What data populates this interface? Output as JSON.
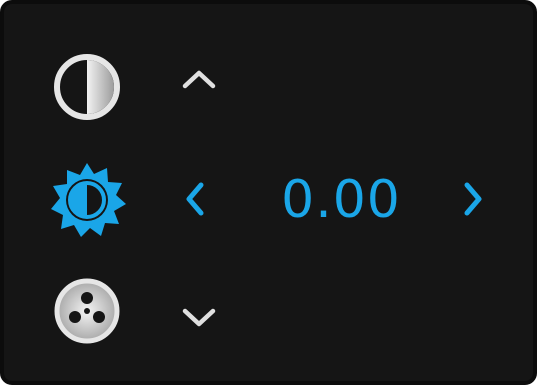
{
  "control": {
    "value": "0.00"
  },
  "icons": {
    "top": "contrast-icon",
    "middle": "brightness-icon",
    "bottom": "saturation-icon",
    "up": "chevron-up-icon",
    "down": "chevron-down-icon",
    "left": "chevron-left-icon",
    "right": "chevron-right-icon"
  },
  "colors": {
    "active": "#1aa6e8",
    "inactive": "#d9d9d9",
    "background": "#151515"
  }
}
